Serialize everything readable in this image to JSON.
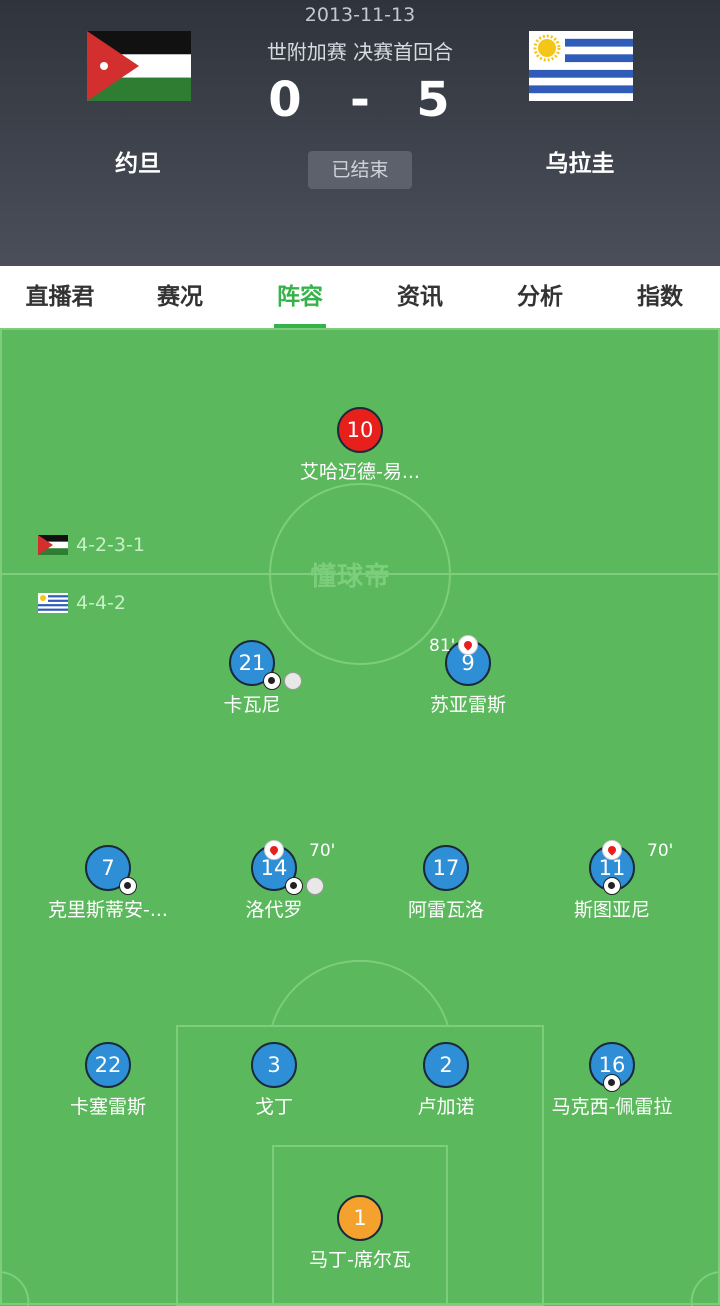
{
  "match": {
    "date": "2013-11-13",
    "competition": "世附加赛 决赛首回合",
    "home_score": "0",
    "separator": "-",
    "away_score": "5",
    "status": "已结束",
    "home_team": "约旦",
    "away_team": "乌拉圭"
  },
  "tabs": [
    {
      "label": "直播君",
      "active": false
    },
    {
      "label": "赛况",
      "active": false
    },
    {
      "label": "阵容",
      "active": true
    },
    {
      "label": "资讯",
      "active": false
    },
    {
      "label": "分析",
      "active": false
    },
    {
      "label": "指数",
      "active": false
    }
  ],
  "pitch": {
    "watermark": "懂球帝",
    "home_formation": "4-2-3-1",
    "away_formation": "4-4-2"
  },
  "players": [
    {
      "number": "10",
      "name": "艾哈迈德-易...",
      "color": "red"
    },
    {
      "number": "21",
      "name": "卡瓦尼",
      "goal": true,
      "assist": true
    },
    {
      "number": "9",
      "name": "苏亚雷斯",
      "sub_off": "81'"
    },
    {
      "number": "7",
      "name": "克里斯蒂安-...",
      "goal": true
    },
    {
      "number": "14",
      "name": "洛代罗",
      "goal": true,
      "assist": true,
      "sub_off": "70'"
    },
    {
      "number": "17",
      "name": "阿雷瓦洛"
    },
    {
      "number": "11",
      "name": "斯图亚尼",
      "goal": true,
      "sub_off": "70'"
    },
    {
      "number": "22",
      "name": "卡塞雷斯"
    },
    {
      "number": "3",
      "name": "戈丁"
    },
    {
      "number": "2",
      "name": "卢加诺"
    },
    {
      "number": "16",
      "name": "马克西-佩雷拉",
      "goal": true
    },
    {
      "number": "1",
      "name": "马丁-席尔瓦",
      "color": "orange"
    }
  ],
  "colors": {
    "accent": "#35b34a",
    "pitch": "#5cb85c",
    "player_blue": "#2f8fd6",
    "player_red": "#e8201c",
    "player_orange": "#f4a12e"
  }
}
